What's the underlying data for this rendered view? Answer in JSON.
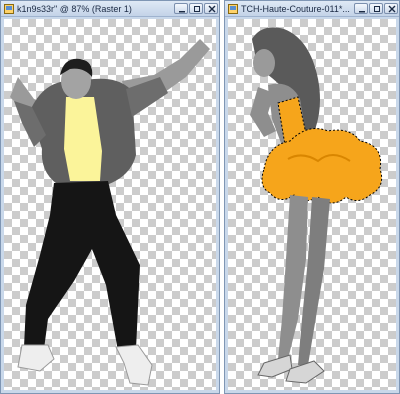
{
  "windows": [
    {
      "title": "k1n9s33r\" @  87% (Raster 1)",
      "controls": [
        "minimize-icon",
        "restore-icon",
        "close-icon"
      ],
      "layer": {
        "name": "dancer-figure",
        "colors": {
          "shirt": "#fbf49a",
          "jacket": "#5f5f5f",
          "pants": "#151515",
          "skin": "#a3a3a3",
          "shoes": "#eeeeee"
        }
      }
    },
    {
      "title": "TCH-Haute-Couture-011*...",
      "controls": [
        "minimize-icon",
        "restore-icon",
        "close-icon"
      ],
      "layer": {
        "name": "pinup-figure",
        "colors": {
          "dress": "#f6a51b",
          "skin": "#8e8e8e",
          "hair": "#5a5a5a",
          "selection": "#000000"
        }
      }
    }
  ],
  "colors": {
    "frame": "#c9d8ea",
    "titlebar": "#dfe9f5",
    "checker": "#cccccc"
  }
}
